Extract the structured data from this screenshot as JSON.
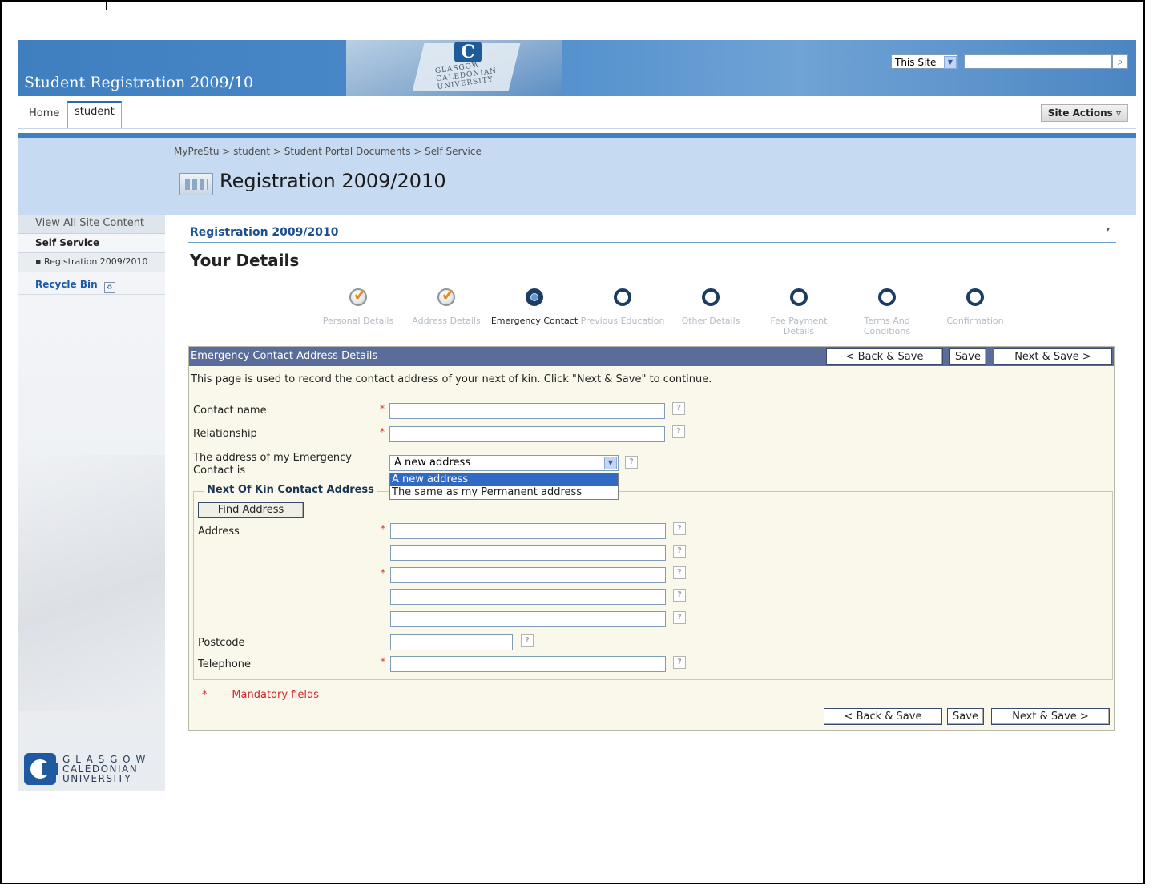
{
  "header": {
    "site_title": "Student Registration 2009/10",
    "search_scope": "This Site",
    "search_value": "",
    "sign_letter": "C",
    "sign_text": "GLASGOW CALEDONIAN UNIVERSITY"
  },
  "nav": {
    "tabs": [
      {
        "label": "Home",
        "selected": false
      },
      {
        "label": "student",
        "selected": true
      }
    ],
    "site_actions": "Site Actions ▿"
  },
  "title_area": {
    "breadcrumb": "MyPreStu > student > Student Portal Documents > Self Service",
    "page_title": "Registration 2009/2010"
  },
  "left_nav": {
    "view_all": "View All Site Content",
    "section": "Self Service",
    "items": [
      "▪ Registration 2009/2010"
    ],
    "recycle_bin": "Recycle Bin"
  },
  "logo": {
    "line1": "G L A S G O W",
    "line2": "CALEDONIAN",
    "line3": "UNIVERSITY"
  },
  "webpart": {
    "title": "Registration 2009/2010",
    "menu": "▾",
    "heading": "Your Details"
  },
  "steps": [
    {
      "label": "Personal Details",
      "state": "done"
    },
    {
      "label": "Address Details",
      "state": "done"
    },
    {
      "label": "Emergency Contact",
      "state": "current"
    },
    {
      "label": "Previous Education",
      "state": "todo"
    },
    {
      "label": "Other Details",
      "state": "todo"
    },
    {
      "label": "Fee Payment Details",
      "state": "todo"
    },
    {
      "label": "Terms And Conditions",
      "state": "todo"
    },
    {
      "label": "Confirmation",
      "state": "todo"
    }
  ],
  "form": {
    "header_title": "Emergency Contact Address Details",
    "back_save": "< Back & Save",
    "save": "Save",
    "next_save": "Next & Save >",
    "intro": "This page is used to record the contact address of your next of kin. Click \"Next & Save\" to continue.",
    "contact_name_label": "Contact name",
    "contact_name_value": "",
    "relationship_label": "Relationship",
    "relationship_value": "",
    "address_of_label_1": "The address of my Emergency",
    "address_of_label_2": "Contact is",
    "address_of_selected": "A new address",
    "address_of_options": [
      "A new address",
      "The same as my Permanent address"
    ],
    "legend": "Next Of Kin Contact Address",
    "find_address": "Find Address",
    "address_label": "Address",
    "address_lines": [
      "",
      "",
      "",
      "",
      ""
    ],
    "postcode_label": "Postcode",
    "postcode_value": "",
    "telephone_label": "Telephone",
    "telephone_value": "",
    "required_marker": "*",
    "help_marker": "?",
    "mandatory_note": "- Mandatory fields"
  },
  "colors": {
    "banner": "#3f7fbf",
    "form_header": "#5a6d9a",
    "form_bg": "#f9f8eb",
    "required": "#e0302c",
    "link": "#1d4f91"
  }
}
